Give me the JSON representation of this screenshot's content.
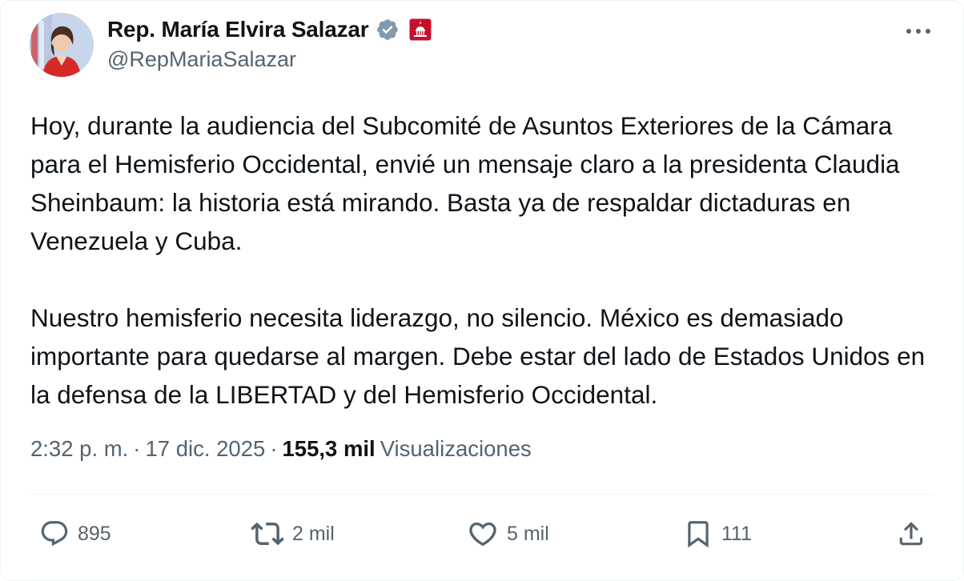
{
  "author": {
    "display_name": "Rep. María Elvira Salazar",
    "handle": "@RepMariaSalazar"
  },
  "tweet": {
    "paragraphs": [
      "Hoy, durante la audiencia del Subcomité de Asuntos Exteriores de la Cámara para el Hemisferio Occidental, envié un mensaje claro a la presidenta Claudia Sheinbaum: la historia está mirando. Basta ya de respaldar dictaduras en Venezuela y Cuba.",
      "Nuestro hemisferio necesita liderazgo, no silencio. México es demasiado importante para quedarse al margen. Debe estar del lado de Estados Unidos en la defensa de la LIBERTAD y del Hemisferio Occidental."
    ]
  },
  "meta": {
    "time": "2:32 p. m.",
    "separator": "·",
    "date": "17 dic. 2025",
    "views_count": "155,3 mil",
    "views_label": "Visualizaciones"
  },
  "actions": {
    "replies": "895",
    "reposts": "2 mil",
    "likes": "5 mil",
    "bookmarks": "111"
  },
  "colors": {
    "text": "#0f1419",
    "secondary": "#536471",
    "verified_badge": "#829aab",
    "affiliation_badge": "#c8102e",
    "divider": "#eff3f4"
  },
  "icons": {
    "verified": "verified-badge-icon",
    "affiliation": "capitol-dome-icon",
    "more": "more-dots-icon",
    "reply": "reply-bubble-icon",
    "repost": "repost-icon",
    "like": "heart-icon",
    "bookmark": "bookmark-icon",
    "share": "share-icon"
  }
}
